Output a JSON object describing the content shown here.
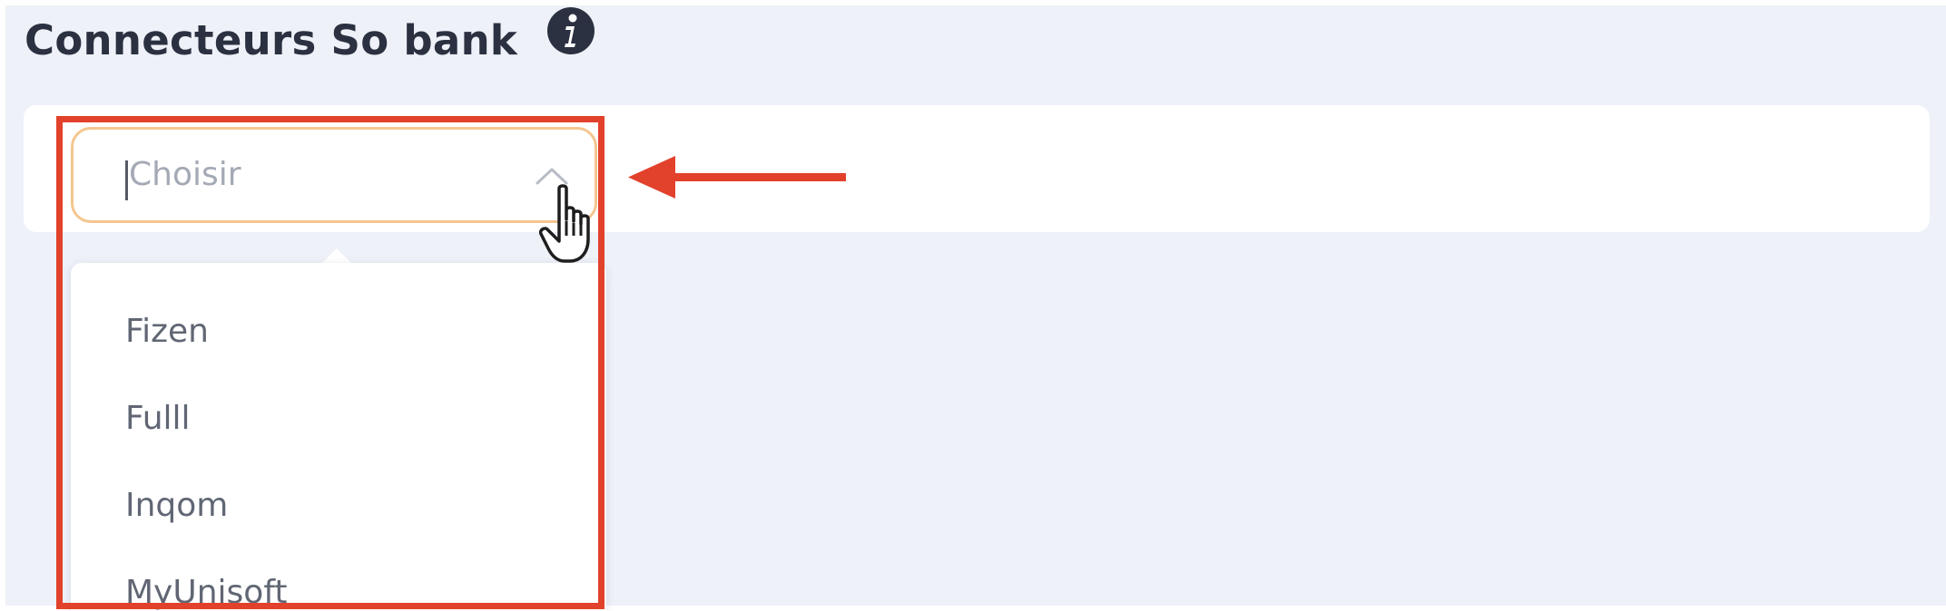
{
  "section": {
    "title": "Connecteurs So bank",
    "info_icon": "info-icon"
  },
  "select": {
    "placeholder": "Choisir",
    "state": "open",
    "chevron_icon": "chevron-up-icon",
    "border_color": "#f4c690"
  },
  "dropdown": {
    "options": [
      {
        "label": "Fizen"
      },
      {
        "label": "Fulll"
      },
      {
        "label": "Inqom"
      },
      {
        "label": "MyUnisoft"
      }
    ]
  },
  "annotation": {
    "highlight_color": "#e2412b",
    "arrow_icon": "arrow-left-icon",
    "cursor_icon": "hand-pointer-icon"
  },
  "colors": {
    "page_background": "#eef1f8",
    "card_background": "#ffffff",
    "title_color": "#2b3140"
  }
}
